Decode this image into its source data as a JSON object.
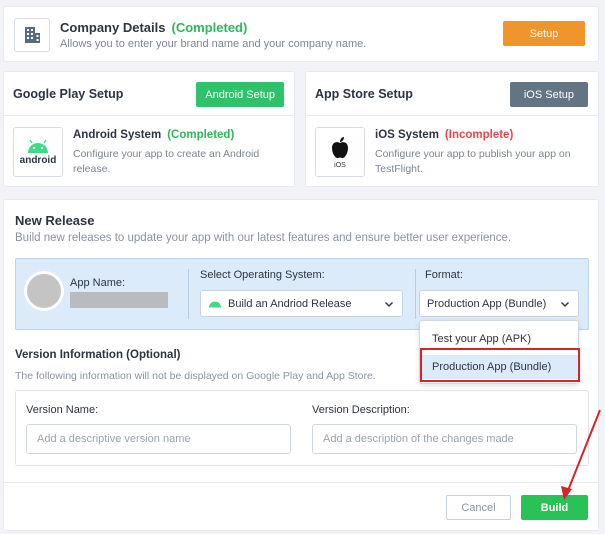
{
  "company": {
    "title": "Company Details",
    "status": "(Completed)",
    "description": "Allows you to enter your brand name and your company name.",
    "button": "Setup",
    "icon": "building-icon"
  },
  "google_play": {
    "header": "Google Play Setup",
    "button": "Android Setup",
    "os_title": "Android System",
    "os_status": "(Completed)",
    "os_desc": "Configure your app to create an Android release.",
    "logo_text": "android"
  },
  "app_store": {
    "header": "App Store Setup",
    "button": "iOS Setup",
    "os_title": "iOS System",
    "os_status": "(Incomplete)",
    "os_desc": "Configure your app to publish your app on TestFlight.",
    "logo_text": "iOS"
  },
  "release": {
    "title": "New Release",
    "subtitle": "Build new releases to update your app with our latest features and ensure better user experience.",
    "app_name_label": "App Name:",
    "os_label": "Select Operating System:",
    "os_value": "Build an Andriod Release",
    "format_label": "Format:",
    "format_value": "Production App (Bundle)",
    "format_options": [
      "Test your App (APK)",
      "Production App (Bundle)"
    ]
  },
  "version": {
    "title": "Version Information (Optional)",
    "subtitle": "The following information will not be displayed on Google Play and App Store.",
    "name_label": "Version Name:",
    "name_placeholder": "Add a descriptive version name",
    "desc_label": "Version Description:",
    "desc_placeholder": "Add a description of the changes made"
  },
  "actions": {
    "cancel": "Cancel",
    "build": "Build"
  },
  "colors": {
    "accent_green": "#28c257",
    "orange": "#f0952b",
    "slate": "#637584",
    "annotation_red": "#d8232a"
  }
}
